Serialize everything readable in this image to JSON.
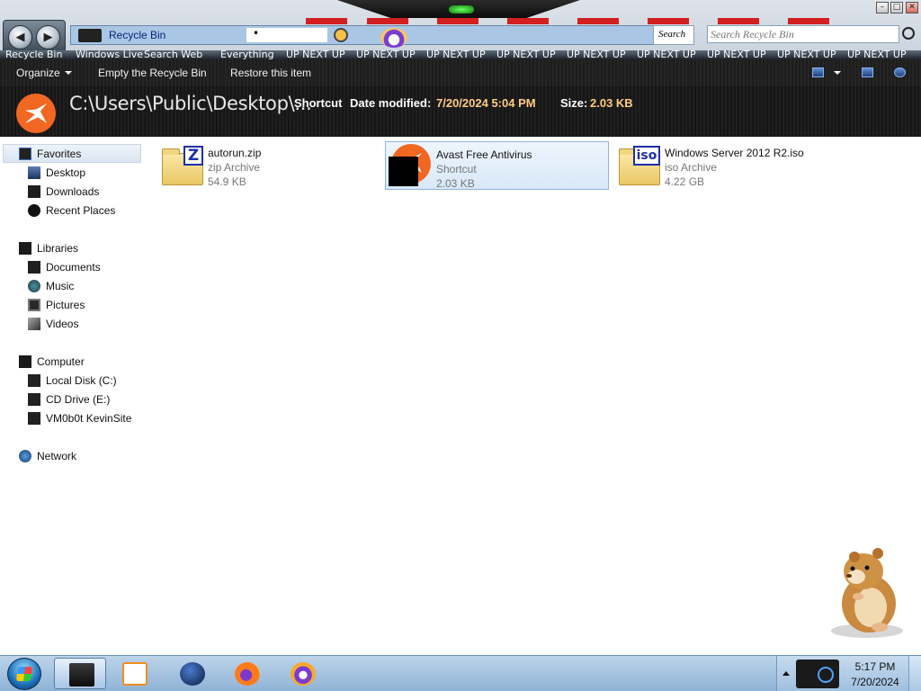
{
  "window": {
    "controls": {
      "minimize": "–",
      "maximize": "□",
      "close": "✕"
    }
  },
  "address": {
    "location": "Recycle Bin",
    "chip_text": "•",
    "search_button": "Search"
  },
  "search": {
    "placeholder": "Search Recycle Bin"
  },
  "ticker": {
    "items": [
      "Recycle Bin",
      "Windows Live",
      "Search Web",
      "Everything",
      "UP NEXT UP",
      "UP NEXT UP",
      "UP NEXT UP",
      "UP NEXT UP",
      "UP NEXT UP",
      "UP NEXT UP",
      "UP NEXT UP",
      "UP NEXT UP",
      "UP NEXT UP"
    ]
  },
  "toolbar": {
    "organize": "Organize",
    "empty": "Empty the Recycle Bin",
    "restore": "Restore this item"
  },
  "details": {
    "path": "C:\\Users\\Public\\Desktop\\...",
    "type": "Shortcut",
    "modified_label": "Date modified:",
    "modified_value": "7/20/2024 5:04 PM",
    "size_label": "Size:",
    "size_value": "2.03 KB"
  },
  "nav": {
    "favorites": "Favorites",
    "desktop": "Desktop",
    "downloads": "Downloads",
    "recent": "Recent Places",
    "libraries": "Libraries",
    "documents": "Documents",
    "music": "Music",
    "pictures": "Pictures",
    "videos": "Videos",
    "computer": "Computer",
    "local_disk": "Local Disk (C:)",
    "cd_drive": "CD Drive (E:)",
    "vm": "VM0b0t KevinSite",
    "network": "Network"
  },
  "files": [
    {
      "name": "autorun.zip",
      "type": "zip Archive",
      "size": "54.9 KB",
      "badge": "Z"
    },
    {
      "name": "Avast Free Antivirus",
      "type": "Shortcut",
      "size": "2.03 KB"
    },
    {
      "name": "Windows Server 2012 R2.iso",
      "type": "iso Archive",
      "size": "4.22 GB",
      "badge": "iso"
    }
  ],
  "clock": {
    "time": "5:17 PM",
    "date": "7/20/2024"
  },
  "colors": {
    "accent": "#f26722",
    "detail_value": "#ffcc80",
    "address_bg": "#a9c6e5",
    "taskbar": "#9ebfdf"
  }
}
